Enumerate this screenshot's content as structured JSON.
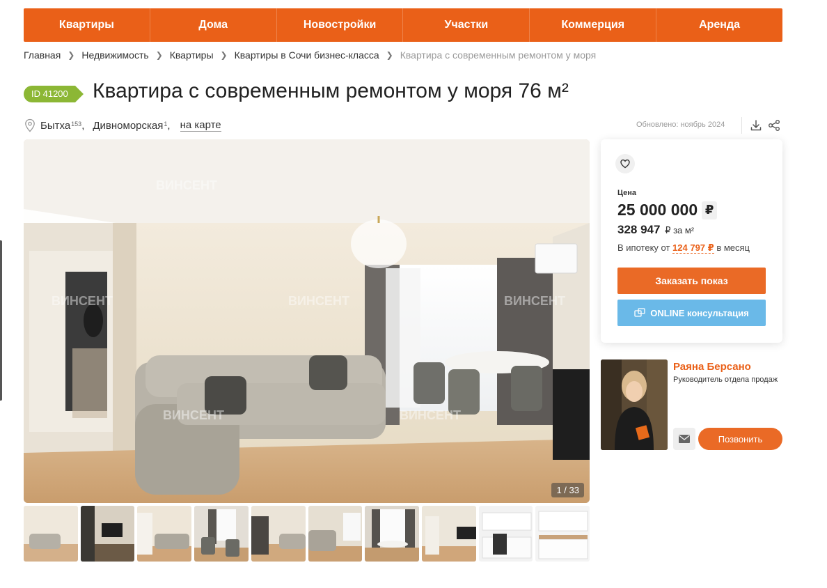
{
  "nav": {
    "items": [
      "Квартиры",
      "Дома",
      "Новостройки",
      "Участки",
      "Коммерция",
      "Аренда"
    ]
  },
  "breadcrumb": {
    "items": [
      "Главная",
      "Недвижимость",
      "Квартиры",
      "Квартиры в Сочи бизнес-класса",
      "Квартира с современным ремонтом у моря"
    ]
  },
  "listing": {
    "id_badge": "ID 41200",
    "title": "Квартира с современным ремонтом у моря 76 м²",
    "location": {
      "district": "Бытха",
      "district_count": "153",
      "street": "Дивноморская",
      "street_count": "1",
      "map_link": "на карте"
    },
    "updated": "Обновлено: ноябрь 2024"
  },
  "gallery": {
    "counter": "1 / 33",
    "watermark": "ВИНСЕНТ"
  },
  "price": {
    "label": "Цена",
    "amount": "25 000 000",
    "currency": "₽",
    "per_m2": "328 947",
    "per_m2_unit": "₽ за м²",
    "mortgage_prefix": "В ипотеку от",
    "mortgage_amount": "124 797 ₽",
    "mortgage_suffix": "в месяц",
    "order_button": "Заказать показ",
    "online_button": "ONLINE консультация"
  },
  "agent": {
    "name": "Раяна Берсано",
    "role": "Руководитель отдела продаж",
    "call_button": "Позвонить"
  },
  "colors": {
    "accent": "#ea6018",
    "badge": "#8cb735",
    "online": "#6ab9e8"
  },
  "icons": [
    "map-pin-icon",
    "download-icon",
    "share-icon",
    "heart-icon",
    "consult-icon",
    "mail-icon"
  ]
}
